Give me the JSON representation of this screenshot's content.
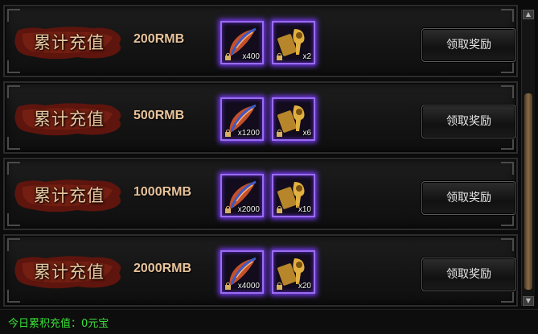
{
  "rows": [
    {
      "label": "累计充值",
      "amount": "200RMB",
      "item1_count": "x400",
      "item2_count": "x2",
      "button": "领取奖励"
    },
    {
      "label": "累计充值",
      "amount": "500RMB",
      "item1_count": "x1200",
      "item2_count": "x6",
      "button": "领取奖励"
    },
    {
      "label": "累计充值",
      "amount": "1000RMB",
      "item1_count": "x2000",
      "item2_count": "x10",
      "button": "领取奖励"
    },
    {
      "label": "累计充值",
      "amount": "2000RMB",
      "item1_count": "x4000",
      "item2_count": "x20",
      "button": "领取奖励"
    }
  ],
  "footer": {
    "text": "今日累积充值：0元宝"
  },
  "icons": {
    "item1": "feather-icon",
    "item2": "golden-relic-icon",
    "lock": "lock-icon"
  },
  "colors": {
    "amount": "#e8c39a",
    "footer_text": "#38e038",
    "item_glow": "#7a3cff",
    "banner": "#6a1810"
  }
}
